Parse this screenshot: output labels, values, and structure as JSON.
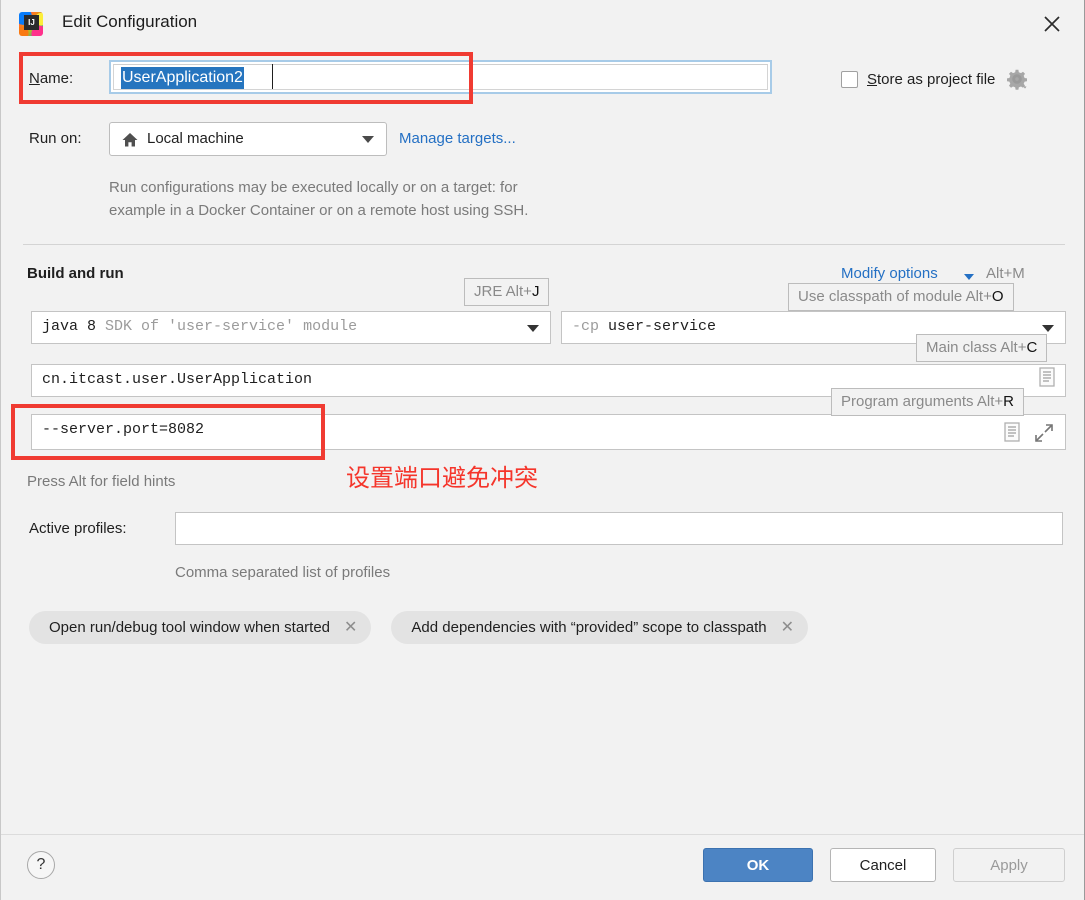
{
  "window": {
    "title": "Edit Configuration",
    "app_icon": "intellij-idea-icon",
    "close_icon": "close-icon"
  },
  "name_row": {
    "label": "Name:",
    "label_mnemonic": "N",
    "value": "UserApplication2",
    "selected": true,
    "selection_color": "#2675bf",
    "focus_border_color": "#a7cbe8",
    "annotation_color": "#f03b32"
  },
  "store_as_project_file": {
    "label": "Store as project file",
    "label_mnemonic": "S",
    "checked": false,
    "gear_icon": "gear-icon"
  },
  "run_on": {
    "label": "Run on:",
    "value": "Local machine",
    "value_icon": "home-icon",
    "manage_targets_link": "Manage targets...",
    "link_color": "#2470c4",
    "description_line1": "Run configurations may be executed locally or on a target: for",
    "description_line2": "example in a Docker Container or on a remote host using SSH."
  },
  "build_and_run": {
    "section_title": "Build and run",
    "modify_options_link": "Modify options",
    "modify_options_shortcut": "Alt+M",
    "jre": {
      "value_bold": "java 8",
      "value_dim": "SDK of 'user-service' module",
      "hint_label": "JRE Alt+",
      "hint_key": "J"
    },
    "classpath": {
      "prefix": "-cp",
      "value": "user-service",
      "hint_label": "Use classpath of module Alt+",
      "hint_key": "O"
    },
    "main_class": {
      "value": "cn.itcast.user.UserApplication",
      "hint_label": "Main class Alt+",
      "hint_key": "C",
      "doc_icon": "document-icon"
    },
    "program_arguments": {
      "value": "--server.port=8082",
      "hint_label": "Program arguments Alt+",
      "hint_key": "R",
      "doc_icon": "document-icon",
      "expand_icon": "expand-icon"
    },
    "field_hints_note": "Press Alt for field hints",
    "annotation_cn": "设置端口避免冲突",
    "annotation_color": "#f5352b"
  },
  "active_profiles": {
    "label": "Active profiles:",
    "value": "",
    "description": "Comma separated list of profiles"
  },
  "chips": [
    {
      "label": "Open run/debug tool window when started",
      "close_icon": "close-chip-icon"
    },
    {
      "label": "Add dependencies with “provided” scope to classpath",
      "close_icon": "close-chip-icon"
    }
  ],
  "footer": {
    "help_label": "?",
    "ok_label": "OK",
    "cancel_label": "Cancel",
    "apply_label": "Apply",
    "ok_color": "#4c84c4",
    "apply_enabled": false
  }
}
